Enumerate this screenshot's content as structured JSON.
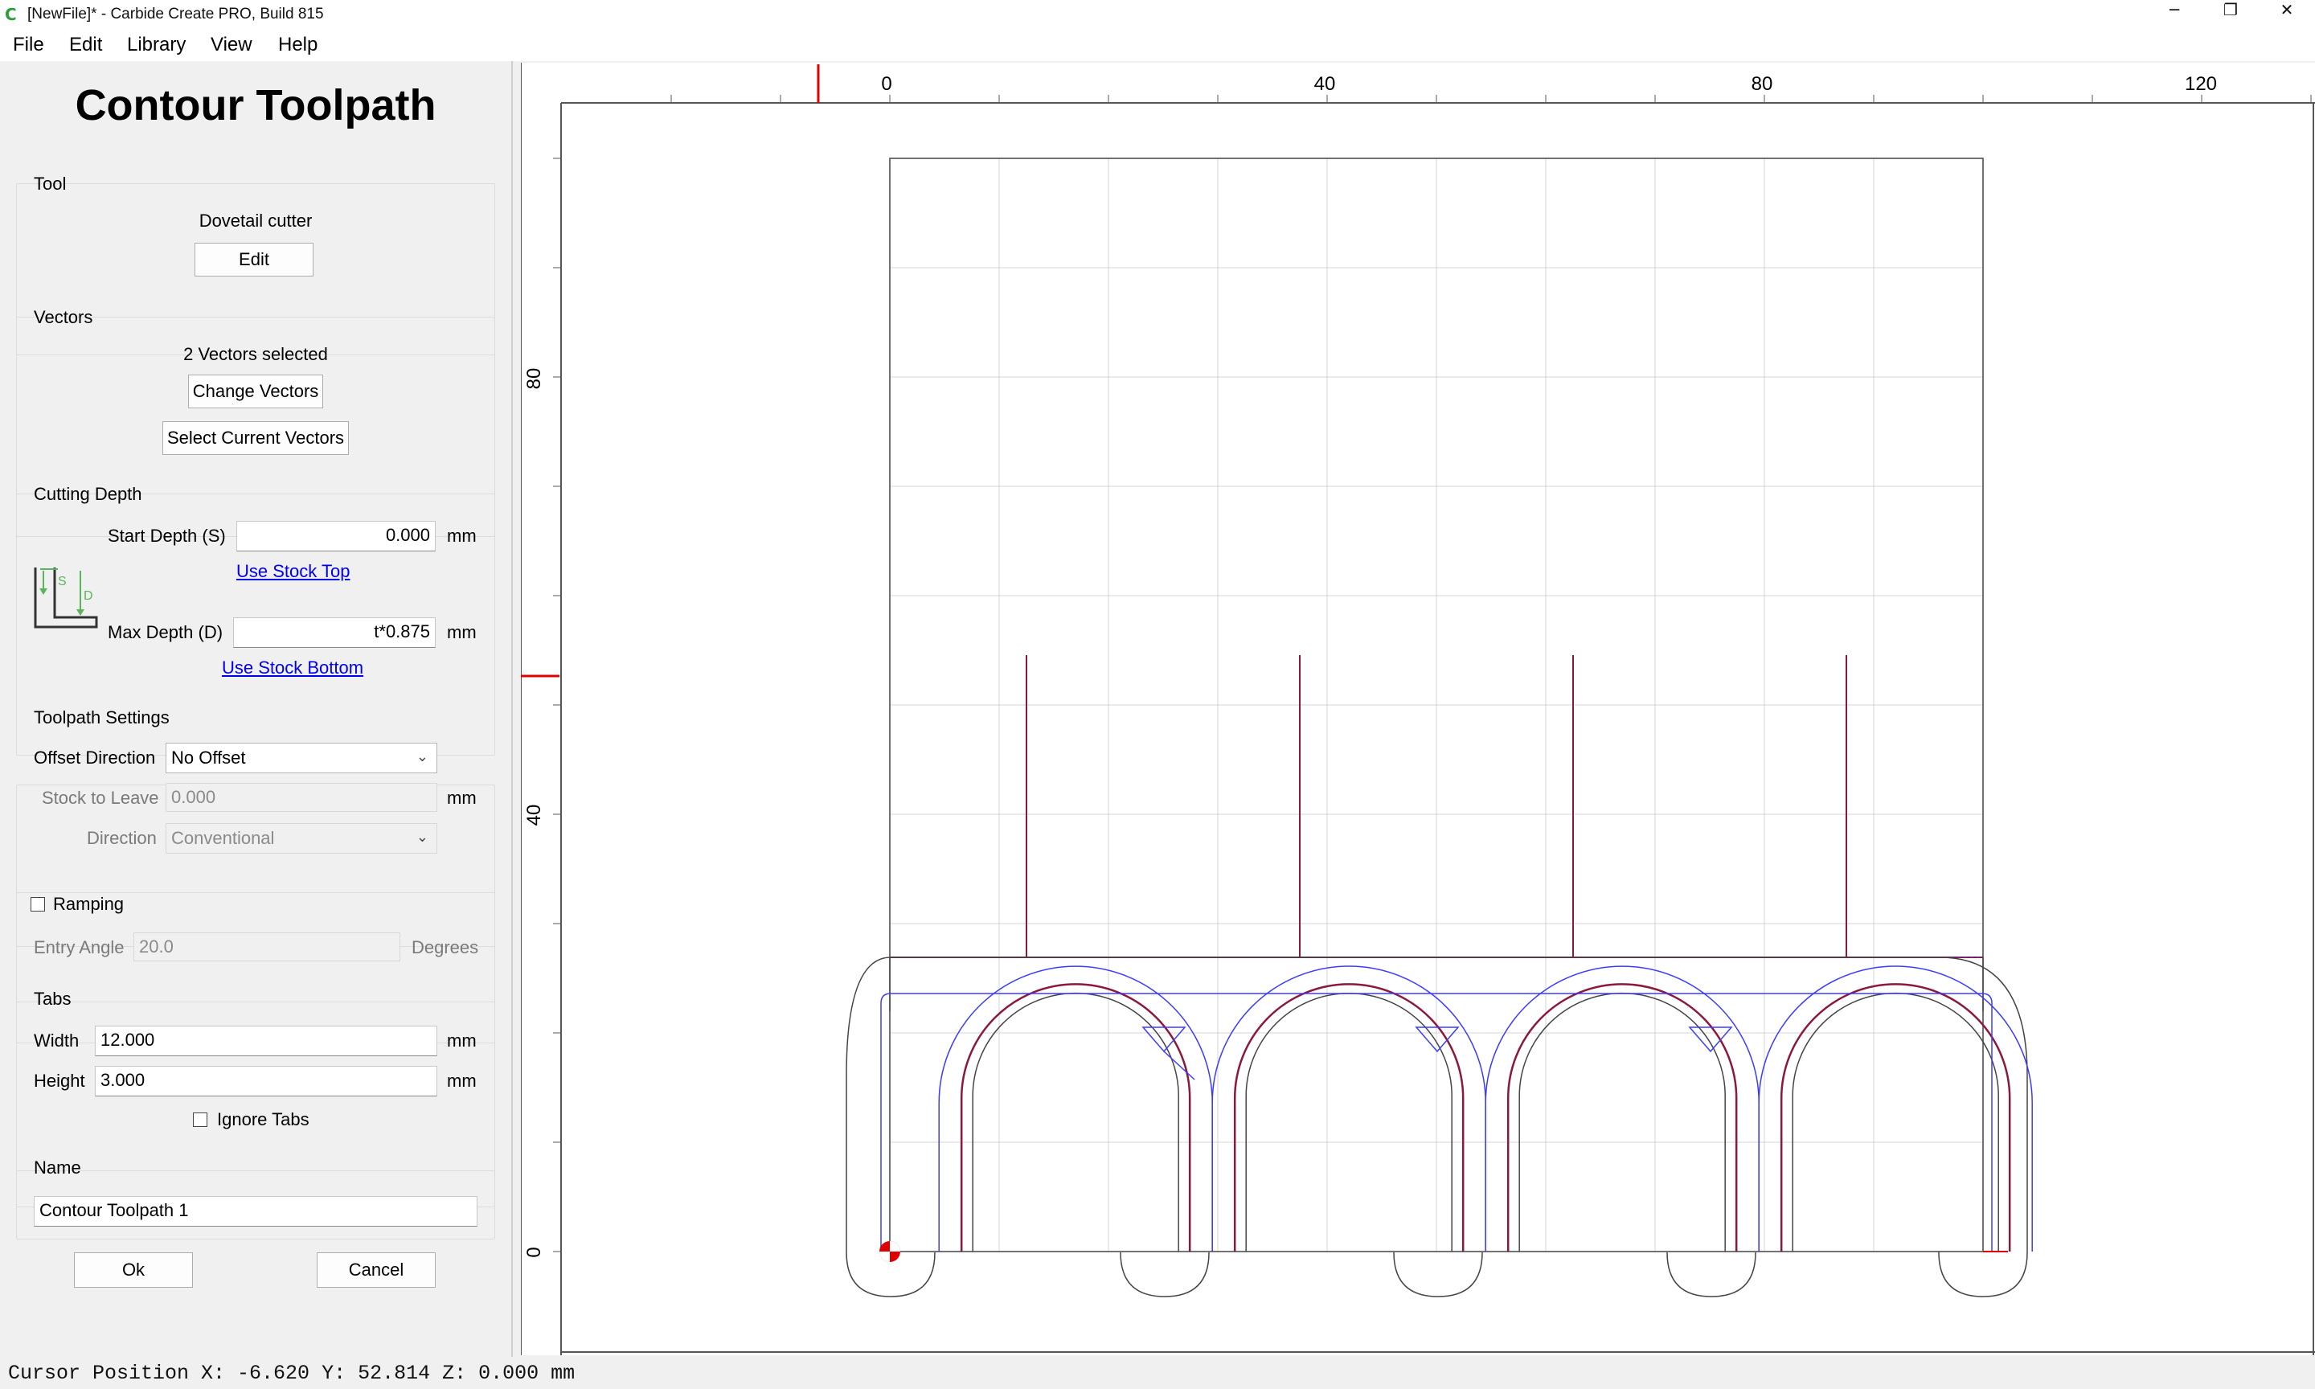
{
  "window": {
    "title": "[NewFile]* - Carbide Create PRO, Build 815",
    "app_icon": "carbide-logo-icon",
    "controls": [
      "minimize-icon",
      "restore-icon",
      "close-icon"
    ],
    "control_glyphs": [
      "─",
      "❐",
      "✕"
    ]
  },
  "menu": {
    "file": "File",
    "edit": "Edit",
    "library": "Library",
    "view": "View",
    "help": "Help"
  },
  "panel": {
    "title": "Contour Toolpath",
    "tool": {
      "group": "Tool",
      "name": "Dovetail cutter",
      "edit_button": "Edit"
    },
    "vectors": {
      "group": "Vectors",
      "status": "2 Vectors selected",
      "change_button": "Change Vectors",
      "select_button": "Select Current Vectors"
    },
    "cutting_depth": {
      "group": "Cutting Depth",
      "start_label": "Start Depth (S)",
      "start_value": "0.000",
      "start_unit": "mm",
      "use_stock_top": "Use Stock Top",
      "max_label": "Max Depth (D)",
      "max_value": "t*0.875",
      "max_unit": "mm",
      "use_stock_bottom": "Use Stock Bottom",
      "diagram_s": "S",
      "diagram_d": "D"
    },
    "toolpath_settings": {
      "group": "Toolpath Settings",
      "offset_label": "Offset Direction",
      "offset_value": "No Offset",
      "stock_label": "Stock to Leave",
      "stock_value": "0.000",
      "stock_unit": "mm",
      "direction_label": "Direction",
      "direction_value": "Conventional"
    },
    "ramping": {
      "label": "Ramping",
      "checked": false,
      "entry_label": "Entry Angle",
      "entry_value": "20.0",
      "entry_unit": "Degrees"
    },
    "tabs": {
      "group": "Tabs",
      "width_label": "Width",
      "width_value": "12.000",
      "width_unit": "mm",
      "height_label": "Height",
      "height_value": "3.000",
      "height_unit": "mm",
      "ignore_label": "Ignore Tabs",
      "ignore_checked": false
    },
    "name": {
      "group": "Name",
      "value": "Contour Toolpath 1"
    },
    "ok_button": "Ok",
    "cancel_button": "Cancel"
  },
  "canvas": {
    "x_ticks": [
      "0",
      "40",
      "80",
      "120"
    ],
    "y_ticks": [
      "80",
      "40",
      "0"
    ],
    "colors": {
      "grid": "#d4d4d4",
      "stock": "#444444",
      "toolpath": "#3b3bff",
      "selected": "#8b1a3a",
      "marker": "#e00000"
    }
  },
  "status": {
    "cursor": "Cursor Position X: -6.620 Y: 52.814 Z: 0.000 mm"
  }
}
